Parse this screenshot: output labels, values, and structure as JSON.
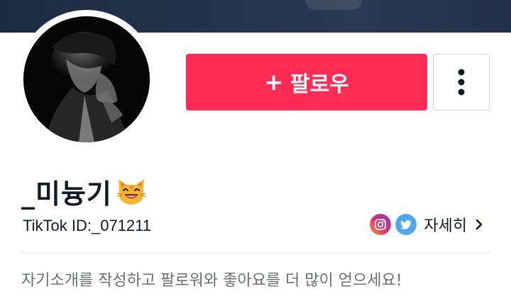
{
  "profile": {
    "username": "_미늉기",
    "username_emoji": "cat-face-emoji",
    "tiktok_id": "TikTok ID:_071211",
    "bio": "자기소개를 작성하고 팔로워와 좋아요를 더 많이 얻으세요!"
  },
  "actions": {
    "follow_plus": "+",
    "follow_label": "팔로우",
    "more_icon": "vertical-ellipsis-icon"
  },
  "social": {
    "icons": [
      "instagram-icon",
      "twitter-icon"
    ],
    "details_label": "자세히"
  },
  "colors": {
    "follow_button": "#fe2c55",
    "cover": "#1f2f46",
    "text_primary": "#161823",
    "text_secondary": "#6d6e73",
    "twitter": "#4fa7ec"
  }
}
